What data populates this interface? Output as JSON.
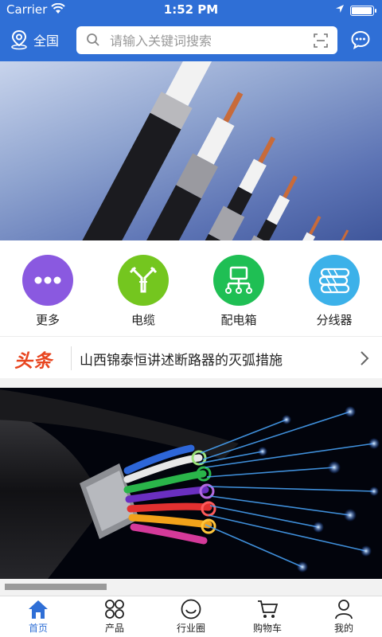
{
  "status": {
    "carrier": "Carrier",
    "time": "1:52 PM",
    "battery_level": 0.95
  },
  "header": {
    "region_label": "全国",
    "search_placeholder": "请输入关键词搜索",
    "accent_color": "#2f6fd6"
  },
  "categories": [
    {
      "label": "更多",
      "icon": "more-dots-icon",
      "color": "#8a59e0"
    },
    {
      "label": "电缆",
      "icon": "cable-icon",
      "color": "#74c61f"
    },
    {
      "label": "配电箱",
      "icon": "distribution-box-icon",
      "color": "#1fbf54"
    },
    {
      "label": "分线器",
      "icon": "splitter-icon",
      "color": "#3cb1e9"
    }
  ],
  "news": {
    "tag": "头条",
    "headline": "山西锦泰恒讲述断路器的灭弧措施",
    "tag_color": "#e8451f"
  },
  "tabs": [
    {
      "label": "首页",
      "icon": "home-icon",
      "active": true
    },
    {
      "label": "产品",
      "icon": "grid-icon",
      "active": false
    },
    {
      "label": "行业圈",
      "icon": "smile-icon",
      "active": false
    },
    {
      "label": "购物车",
      "icon": "cart-icon",
      "active": false
    },
    {
      "label": "我的",
      "icon": "user-icon",
      "active": false
    }
  ]
}
